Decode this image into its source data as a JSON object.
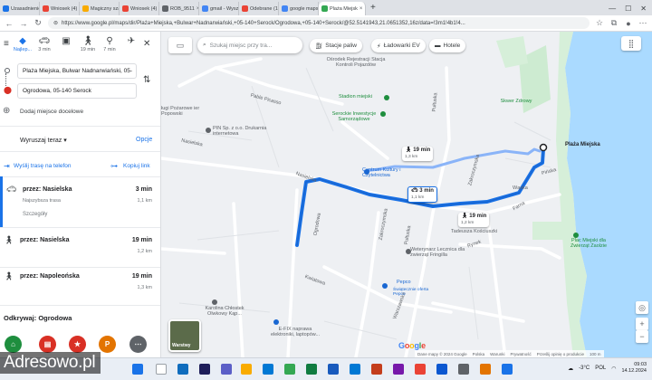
{
  "browser": {
    "tabs": [
      {
        "title": "Uzasadnienie",
        "color": "#1a73e8"
      },
      {
        "title": "Wniosek (4)",
        "color": "#ea4335"
      },
      {
        "title": "Magiczny szal",
        "color": "#f9ab00"
      },
      {
        "title": "Wniosek (4)",
        "color": "#ea4335"
      },
      {
        "title": "ROB_9511",
        "color": "#5f6368"
      },
      {
        "title": "gmail - Wyszuk",
        "color": "#4285f4"
      },
      {
        "title": "Odebrane (1)",
        "color": "#ea4335"
      },
      {
        "title": "google maps",
        "color": "#4285f4"
      },
      {
        "title": "Plaża Miejsk",
        "color": "#34a853",
        "active": true
      }
    ],
    "url": "https://www.google.pl/maps/dir/Plaża+Miejska,+Bulwar+Nadnarwiański,+05-140+Serock/Ogrodowa,+05-140+Serock/@52.5141943,21.0651352,16z/data=!3m1!4b1!4..."
  },
  "panel": {
    "modes": [
      {
        "icon": "compass-diamond",
        "label": "Najlep..."
      },
      {
        "icon": "car",
        "label": "3 min"
      },
      {
        "icon": "bus",
        "label": ""
      },
      {
        "icon": "walk",
        "label": "19 min"
      },
      {
        "icon": "bike",
        "label": "7 min"
      },
      {
        "icon": "plane",
        "label": ""
      }
    ],
    "origin": "Plaża Miejska, Bulwar Nadnarwiański, 05-",
    "destination": "Ogrodowa, 05-140 Serock",
    "add_stop": "Dodaj miejsce docelowe",
    "depart": "Wyruszaj teraz",
    "options": "Opcje",
    "send_to_phone": "Wyślij trasę na telefon",
    "copy_link": "Kopiuj link",
    "routes": [
      {
        "mode": "car",
        "name": "przez: Nasielska",
        "time": "3 min",
        "sub": "Najszybsza trasa",
        "distance": "1,1 km",
        "details": "Szczegóły"
      },
      {
        "mode": "walk",
        "name": "przez: Nasielska",
        "time": "19 min",
        "sub": "",
        "distance": "1,2 km"
      },
      {
        "mode": "walk",
        "name": "przez: Napoleońska",
        "time": "19 min",
        "sub": "",
        "distance": "1,3 km"
      }
    ],
    "explore": "Odkrywaj: Ogrodowa",
    "explore_colors": [
      "#1e8e3e",
      "#d93025",
      "#d93025",
      "#e37400",
      "#5f6368"
    ],
    "explore_letter": "P"
  },
  "map": {
    "search_placeholder": "Szukaj miejsc przy tra...",
    "chips": [
      "Stacje paliw",
      "Ładowarki EV",
      "Hotele"
    ],
    "streets": [
      "Nasielska",
      "Pułtuska",
      "Pułtuska",
      "Zakroczymska",
      "Ogrodowa",
      "Kwiatowa",
      "Warszawska",
      "Rynek",
      "Pable Picasso",
      "Tadeusza Kościuszki",
      "Wąska",
      "Pińska",
      "Farna",
      "Zakroczymska"
    ],
    "pois": [
      "Ośrodek Rejestracji Stacja Kontroli Pojazdów",
      "Stadion miejski",
      "Serockie Inwestycje Samorządowe",
      "PIN Sp. z o.o. Drukarnia internetowa",
      "Centrum Kultury i Czytelnictwa",
      "Weterynarz Lecznica dla zwierząt Fringilla",
      "Pepco",
      "Świątecznie oferta Pepco",
      "Karolina Chłostek Olwkowy Kąp...",
      "E-FIX naprawa elektroniki, laptopów...",
      "Plaża Miejska",
      "Plac Miejski dla Zwierząt Zaolzie",
      "Skwer Zdrowy",
      "ługi Pożarowe ier Popowski"
    ],
    "eta_walk_1": {
      "time": "19 min",
      "dist": "1,3 km"
    },
    "eta_car": {
      "time": "3 min",
      "dist": "1,1 km"
    },
    "eta_walk_2": {
      "time": "19 min",
      "dist": "1,2 km"
    },
    "origin_label": "Plaża Miejska",
    "layers_label": "Warstwy",
    "google": "Google",
    "footer": [
      "Dane mapy © 2024 Google",
      "Polska",
      "Warunki",
      "Prywatność",
      "Prześlij opinię o produkcie",
      "100 m"
    ],
    "route_color": "#1a73e8",
    "walk_color": "#8ab4f8",
    "water_color": "#aadaff"
  },
  "taskbar": {
    "watermark": "Adresowo.pl",
    "temp": "-3°C",
    "time": "09:03",
    "date": "14.12.2024",
    "lang": "POL"
  }
}
